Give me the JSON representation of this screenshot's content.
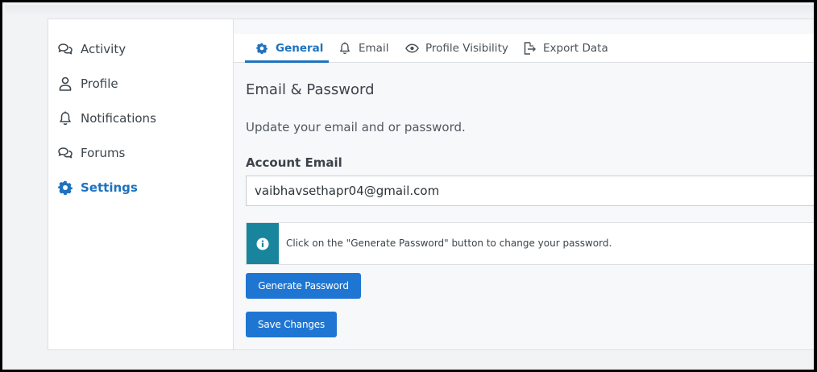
{
  "sidebar": {
    "items": [
      {
        "label": "Activity",
        "icon": "chat-bubbles-icon"
      },
      {
        "label": "Profile",
        "icon": "user-icon"
      },
      {
        "label": "Notifications",
        "icon": "bell-icon"
      },
      {
        "label": "Forums",
        "icon": "chat-bubbles-icon"
      },
      {
        "label": "Settings",
        "icon": "gear-icon",
        "active": true
      }
    ]
  },
  "tabs": [
    {
      "label": "General",
      "icon": "gear-icon",
      "active": true
    },
    {
      "label": "Email",
      "icon": "bell-icon"
    },
    {
      "label": "Profile Visibility",
      "icon": "eye-icon"
    },
    {
      "label": "Export Data",
      "icon": "export-icon"
    }
  ],
  "main": {
    "section_title": "Email & Password",
    "section_description": "Update your email and or password.",
    "email_label": "Account Email",
    "email_value": "vaibhavsethapr04@gmail.com",
    "notice_text": "Click on the \"Generate Password\" button to change your password.",
    "generate_button": "Generate Password",
    "save_button": "Save Changes"
  },
  "colors": {
    "accent": "#1e73be",
    "button": "#1f76d2",
    "info": "#18859c"
  }
}
